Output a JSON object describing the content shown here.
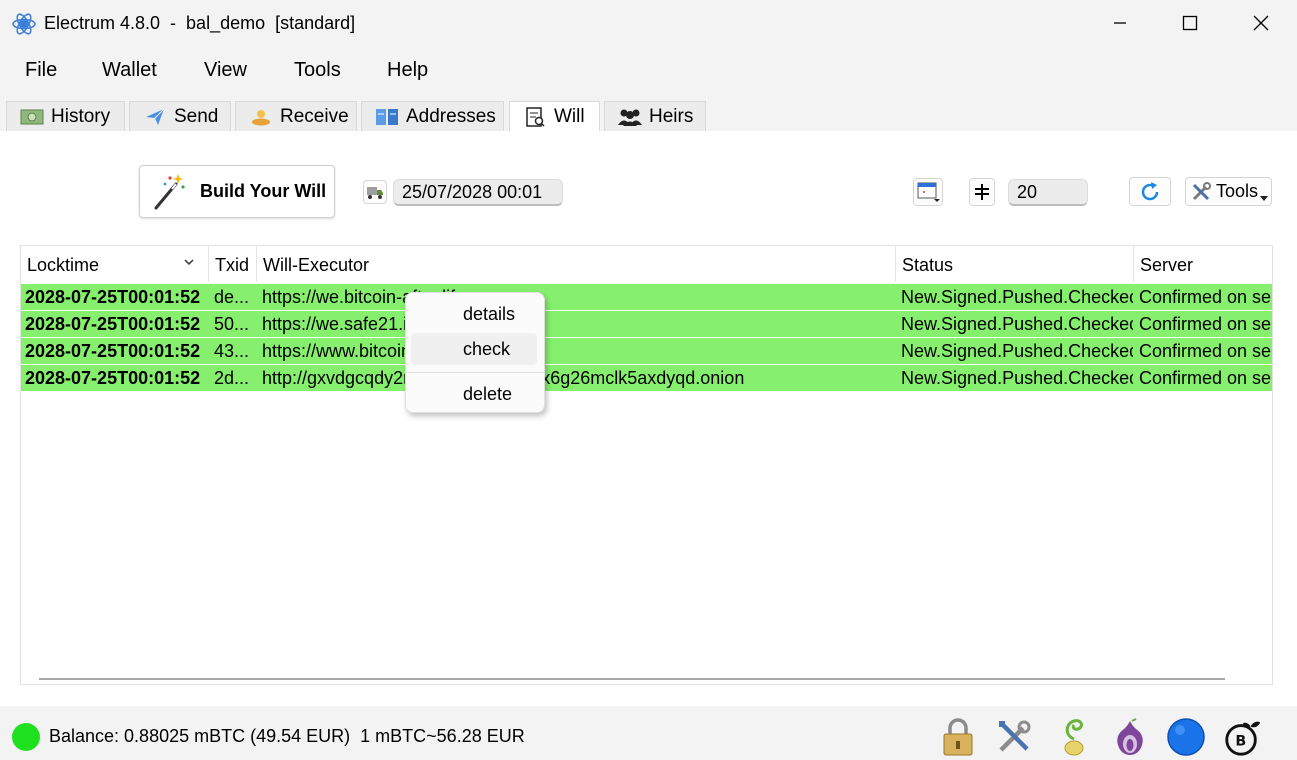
{
  "window": {
    "title": "Electrum 4.8.0  -  bal_demo  [standard]",
    "controls": [
      "minimize-icon",
      "maximize-icon",
      "close-icon"
    ]
  },
  "menu": [
    "File",
    "Wallet",
    "View",
    "Tools",
    "Help"
  ],
  "tabs": [
    {
      "label": "History",
      "icon": "history-icon"
    },
    {
      "label": "Send",
      "icon": "send-icon"
    },
    {
      "label": "Receive",
      "icon": "receive-icon"
    },
    {
      "label": "Addresses",
      "icon": "addresses-icon"
    },
    {
      "label": "Will",
      "icon": "will-icon",
      "active": true
    },
    {
      "label": "Heirs",
      "icon": "heirs-icon"
    }
  ],
  "toolbar": {
    "build_label": "Build Your Will",
    "locktime_value": "25/07/2028 00:01",
    "threshold_value": "20",
    "tools_label": "Tools"
  },
  "table": {
    "headers": [
      "Locktime",
      "Txid",
      "Will-Executor",
      "Status",
      "Server"
    ],
    "rows": [
      {
        "locktime": "2028-07-25T00:01:52",
        "txid": "de...",
        "executor": "https://we.bitcoin-after.life",
        "status": "New.Signed.Pushed.Checked",
        "server": "Confirmed on server"
      },
      {
        "locktime": "2028-07-25T00:01:52",
        "txid": "50...",
        "executor": "https://we.safe21.it",
        "status": "New.Signed.Pushed.Checked",
        "server": "Confirmed on server"
      },
      {
        "locktime": "2028-07-25T00:01:52",
        "txid": "43...",
        "executor": "https://www.bitcoin-after.life",
        "status": "New.Signed.Pushed.Checked",
        "server": "Confirmed on server"
      },
      {
        "locktime": "2028-07-25T00:01:52",
        "txid": "2d...",
        "executor": "http://gxvdgcqdy2r2aqoob73xtkqz4x6g26mclk5axdyqd.onion",
        "status": "New.Signed.Pushed.Checked",
        "server": "Confirmed on server"
      }
    ]
  },
  "context_menu": {
    "items": [
      "details",
      "check",
      "delete"
    ]
  },
  "status": {
    "balance": "Balance: 0.88025 mBTC (49.54 EUR)  1 mBTC~56.28 EUR",
    "dot_color": "#1ee01e",
    "icons": [
      "lock-icon",
      "preferences-icon",
      "seed-icon",
      "tor-icon",
      "network-icon",
      "bal-plugin-icon"
    ]
  },
  "colors": {
    "row_highlight": "#86f06e",
    "accent": "#1e88e5"
  }
}
